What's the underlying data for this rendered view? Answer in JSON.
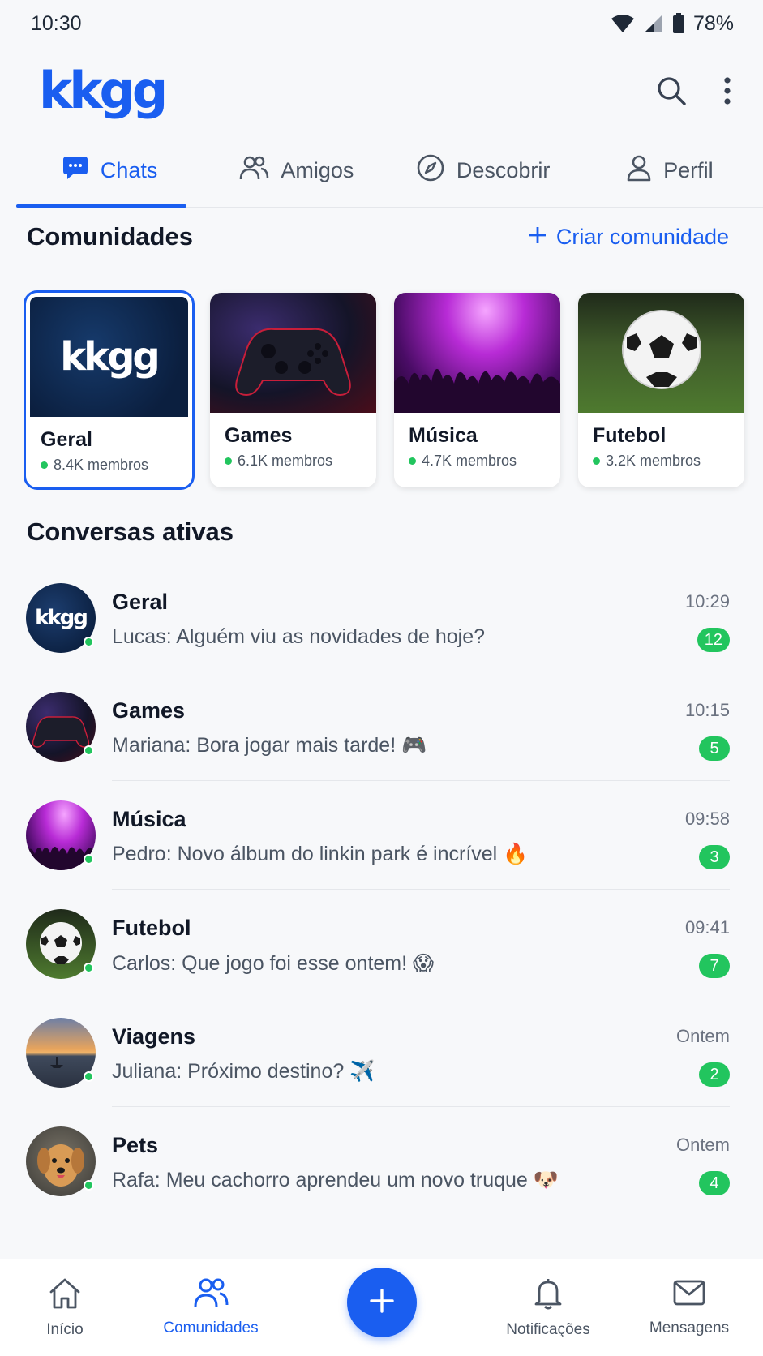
{
  "status_bar": {
    "time": "10:30",
    "battery": "78%"
  },
  "header": {
    "logo": "kkgg"
  },
  "tabs": [
    {
      "label": "Chats",
      "icon": "chat-icon",
      "active": true
    },
    {
      "label": "Amigos",
      "icon": "friends-icon",
      "active": false
    },
    {
      "label": "Descobrir",
      "icon": "compass-icon",
      "active": false
    },
    {
      "label": "Perfil",
      "icon": "profile-icon",
      "active": false
    }
  ],
  "communities_section": {
    "title": "Comunidades",
    "create_label": "Criar comunidade",
    "cards": [
      {
        "name": "Geral",
        "members": "8.4K membros",
        "image": "kkgg-logo",
        "logo_text": "kkgg"
      },
      {
        "name": "Games",
        "members": "6.1K membros",
        "image": "game-controller"
      },
      {
        "name": "Música",
        "members": "4.7K membros",
        "image": "concert-crowd"
      },
      {
        "name": "Futebol",
        "members": "3.2K membros",
        "image": "soccer-ball"
      }
    ]
  },
  "chats_section": {
    "title": "Conversas ativas",
    "chats": [
      {
        "name": "Geral",
        "message": "Lucas: Alguém viu as novidades de hoje?",
        "time": "10:29",
        "unread": "12",
        "avatar": "kkgg-logo",
        "avatar_text": "kkgg"
      },
      {
        "name": "Games",
        "message": "Mariana: Bora jogar mais tarde! 🎮",
        "time": "10:15",
        "unread": "5",
        "avatar": "game-controller"
      },
      {
        "name": "Música",
        "message": "Pedro: Novo álbum do linkin park é incrível 🔥",
        "time": "09:58",
        "unread": "3",
        "avatar": "concert-crowd"
      },
      {
        "name": "Futebol",
        "message": "Carlos: Que jogo foi esse ontem! 😱",
        "time": "09:41",
        "unread": "7",
        "avatar": "soccer-ball"
      },
      {
        "name": "Viagens",
        "message": "Juliana: Próximo destino? ✈️",
        "time": "Ontem",
        "unread": "2",
        "avatar": "sunset-boat"
      },
      {
        "name": "Pets",
        "message": "Rafa: Meu cachorro aprendeu um novo truque 🐶",
        "time": "Ontem",
        "unread": "4",
        "avatar": "dog"
      }
    ]
  },
  "bottom_nav": {
    "items": [
      {
        "label": "Início",
        "icon": "home-icon"
      },
      {
        "label": "Comunidades",
        "icon": "communities-icon",
        "active": true
      },
      {
        "label": "Notificações",
        "icon": "bell-icon"
      },
      {
        "label": "Mensagens",
        "icon": "mail-icon"
      }
    ],
    "fab_icon": "plus-icon"
  },
  "colors": {
    "accent": "#1a5ef0",
    "online": "#22c55e",
    "badge": "#22c55e"
  }
}
